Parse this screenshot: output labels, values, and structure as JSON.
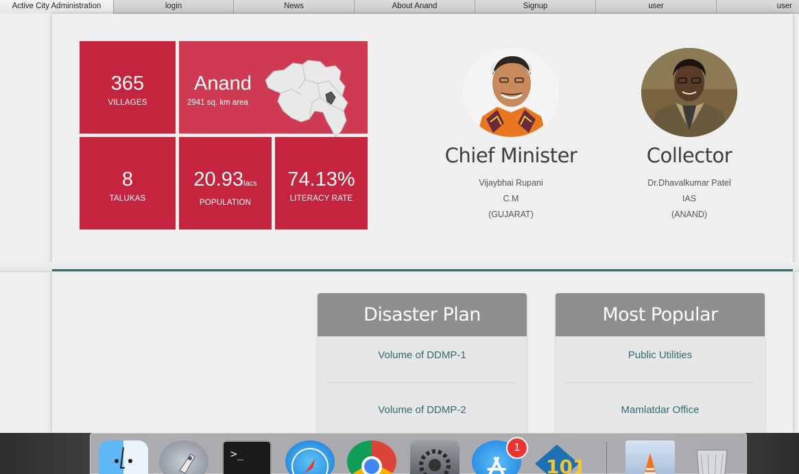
{
  "topnav": {
    "items": [
      {
        "label": "Active City Administration"
      },
      {
        "label": "login"
      },
      {
        "label": "News"
      },
      {
        "label": "About Anand"
      },
      {
        "label": "Signup"
      },
      {
        "label": "user"
      },
      {
        "label": "user"
      }
    ]
  },
  "stats": {
    "villages": {
      "value": "365",
      "label": "VILLAGES"
    },
    "district": {
      "name": "Anand",
      "area": "2941 sq. km area"
    },
    "talukas": {
      "value": "8",
      "label": "TALUKAS"
    },
    "population": {
      "value": "20.93",
      "unit": "lacs",
      "label": "POPULATION"
    },
    "literacy": {
      "value": "74.13%",
      "label": "LITERACY RATE"
    }
  },
  "officials": {
    "cm": {
      "role": "Chief Minister",
      "name": "Vijaybhai Rupani",
      "title": "C.M",
      "place": "(GUJARAT)"
    },
    "collector": {
      "role": "Collector",
      "name": "Dr.Dhavalkumar Patel",
      "title": "IAS",
      "place": "(ANAND)"
    }
  },
  "panels": {
    "disaster": {
      "title": "Disaster Plan",
      "links": [
        "Volume of DDMP-1",
        "Volume of DDMP-2"
      ]
    },
    "popular": {
      "title": "Most Popular",
      "links": [
        "Public Utilities",
        "Mamlatdar Office"
      ]
    }
  },
  "dock": {
    "apps": [
      "finder-icon",
      "launchpad-icon",
      "terminal-icon",
      "safari-icon",
      "chrome-icon",
      "system-preferences-icon",
      "app-store-icon",
      "game-icon",
      "preview-icon",
      "trash-icon"
    ],
    "app_store_badge": "1",
    "terminal_prompt": ">_"
  },
  "colors": {
    "tile": "#c4243d",
    "tile_light": "#cf3a52",
    "accent": "#2f6f6b",
    "link": "#2f6b73",
    "panel_head": "#8e8e8e"
  }
}
